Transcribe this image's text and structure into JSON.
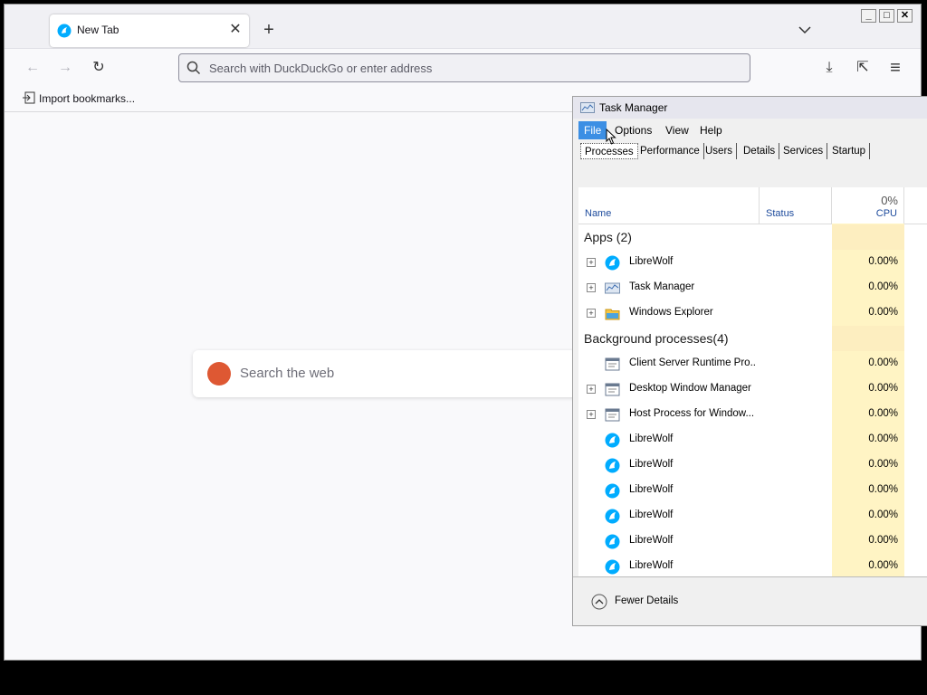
{
  "browser": {
    "tab": {
      "title": "New Tab",
      "close_glyph": "✕"
    },
    "new_tab_glyph": "+",
    "window_controls": {
      "minimize": "_",
      "maximize": "□",
      "close": "✕"
    },
    "urlbar": {
      "placeholder": "Search with DuckDuckGo or enter address"
    },
    "bookmarks": {
      "import_label": "Import bookmarks..."
    },
    "content_search": {
      "placeholder": "Search the web"
    },
    "nav_glyphs": {
      "back": "←",
      "forward": "→",
      "reload": "↻",
      "downloads": "⤓",
      "extensions": "⇱",
      "menu": "≡"
    }
  },
  "task_manager": {
    "title": "Task Manager",
    "menu": [
      "File",
      "Options",
      "View",
      "Help"
    ],
    "tabs": [
      "Processes",
      "Performance",
      "Users",
      "Details",
      "Services",
      "Startup"
    ],
    "columns": {
      "name": "Name",
      "status": "Status",
      "cpu": "CPU",
      "cpu_total": "0%"
    },
    "groups": [
      {
        "label": "Apps (2)",
        "processes": [
          {
            "name": "LibreWolf",
            "cpu": "0.00%",
            "icon": "librewolf-icon",
            "expandable": true
          },
          {
            "name": "Task Manager",
            "cpu": "0.00%",
            "icon": "task-manager-icon",
            "expandable": true
          },
          {
            "name": "Windows Explorer",
            "cpu": "0.00%",
            "icon": "folder-icon",
            "expandable": true
          }
        ]
      },
      {
        "label": "Background processes(4)",
        "processes": [
          {
            "name": "Client Server Runtime Pro...",
            "cpu": "0.00%",
            "icon": "system-process-icon",
            "expandable": false
          },
          {
            "name": "Desktop Window Manager",
            "cpu": "0.00%",
            "icon": "system-process-icon",
            "expandable": true
          },
          {
            "name": "Host Process for Window...",
            "cpu": "0.00%",
            "icon": "system-process-icon",
            "expandable": true
          },
          {
            "name": "LibreWolf",
            "cpu": "0.00%",
            "icon": "librewolf-icon",
            "expandable": false
          },
          {
            "name": "LibreWolf",
            "cpu": "0.00%",
            "icon": "librewolf-icon",
            "expandable": false
          },
          {
            "name": "LibreWolf",
            "cpu": "0.00%",
            "icon": "librewolf-icon",
            "expandable": false
          },
          {
            "name": "LibreWolf",
            "cpu": "0.00%",
            "icon": "librewolf-icon",
            "expandable": false
          },
          {
            "name": "LibreWolf",
            "cpu": "0.00%",
            "icon": "librewolf-icon",
            "expandable": false
          },
          {
            "name": "LibreWolf",
            "cpu": "0.00%",
            "icon": "librewolf-icon",
            "expandable": false
          }
        ]
      }
    ],
    "footer": {
      "label": "Fewer Details"
    }
  },
  "colors": {
    "accent": "#3c8fe4",
    "cpu_highlight": "#fff4c4",
    "ddg": "#de5833",
    "librewolf": "#00acff"
  }
}
